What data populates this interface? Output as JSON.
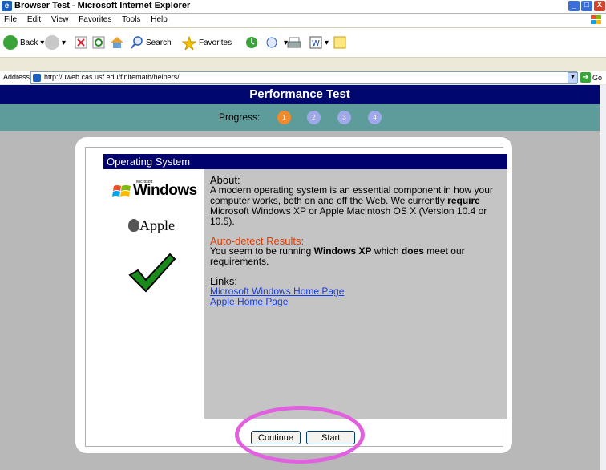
{
  "window": {
    "title": "Browser Test - Microsoft Internet Explorer",
    "minimize": "_",
    "maximize": "□",
    "close": "X"
  },
  "menu": {
    "items": [
      "File",
      "Edit",
      "View",
      "Favorites",
      "Tools",
      "Help"
    ]
  },
  "toolbar": {
    "back_label": "Back",
    "search_label": "Search",
    "favorites_label": "Favorites"
  },
  "address": {
    "label": "Address",
    "url": "http://uweb.cas.usf.edu/finitemath/helpers/",
    "go_label": "Go"
  },
  "page": {
    "header_title": "Performance Test",
    "progress_label": "Progress:",
    "steps": [
      "1",
      "2",
      "3",
      "4"
    ],
    "active_step": 1,
    "section_title": "Operating System",
    "logos": {
      "windows_small": "Microsoft",
      "windows_text": "Windows",
      "apple_text": "Apple"
    },
    "about_heading": "About:",
    "about_text_1": "A modern operating system is an essential component in how your computer works, both on and off the Web. We currently ",
    "about_bold": "require",
    "about_text_2": " Microsoft Windows XP or Apple Macintosh OS X (Version 10.4 or 10.5).",
    "autodetect_heading": "Auto-detect Results:",
    "autodetect_text_1": "You seem to be running ",
    "autodetect_os": "Windows XP",
    "autodetect_text_2": " which ",
    "autodetect_does": "does",
    "autodetect_text_3": " meet our requirements.",
    "links_heading": "Links:",
    "links": [
      "Microsoft Windows Home Page",
      "Apple Home Page"
    ],
    "continue_button": "Continue",
    "start_button": "Start"
  },
  "colors": {
    "header_bg": "#000870",
    "progress_bg": "#5e9c9c",
    "active_step": "#f08a2c",
    "inactive_step": "#9fa8e8",
    "highlight_ellipse": "#e060e0"
  }
}
